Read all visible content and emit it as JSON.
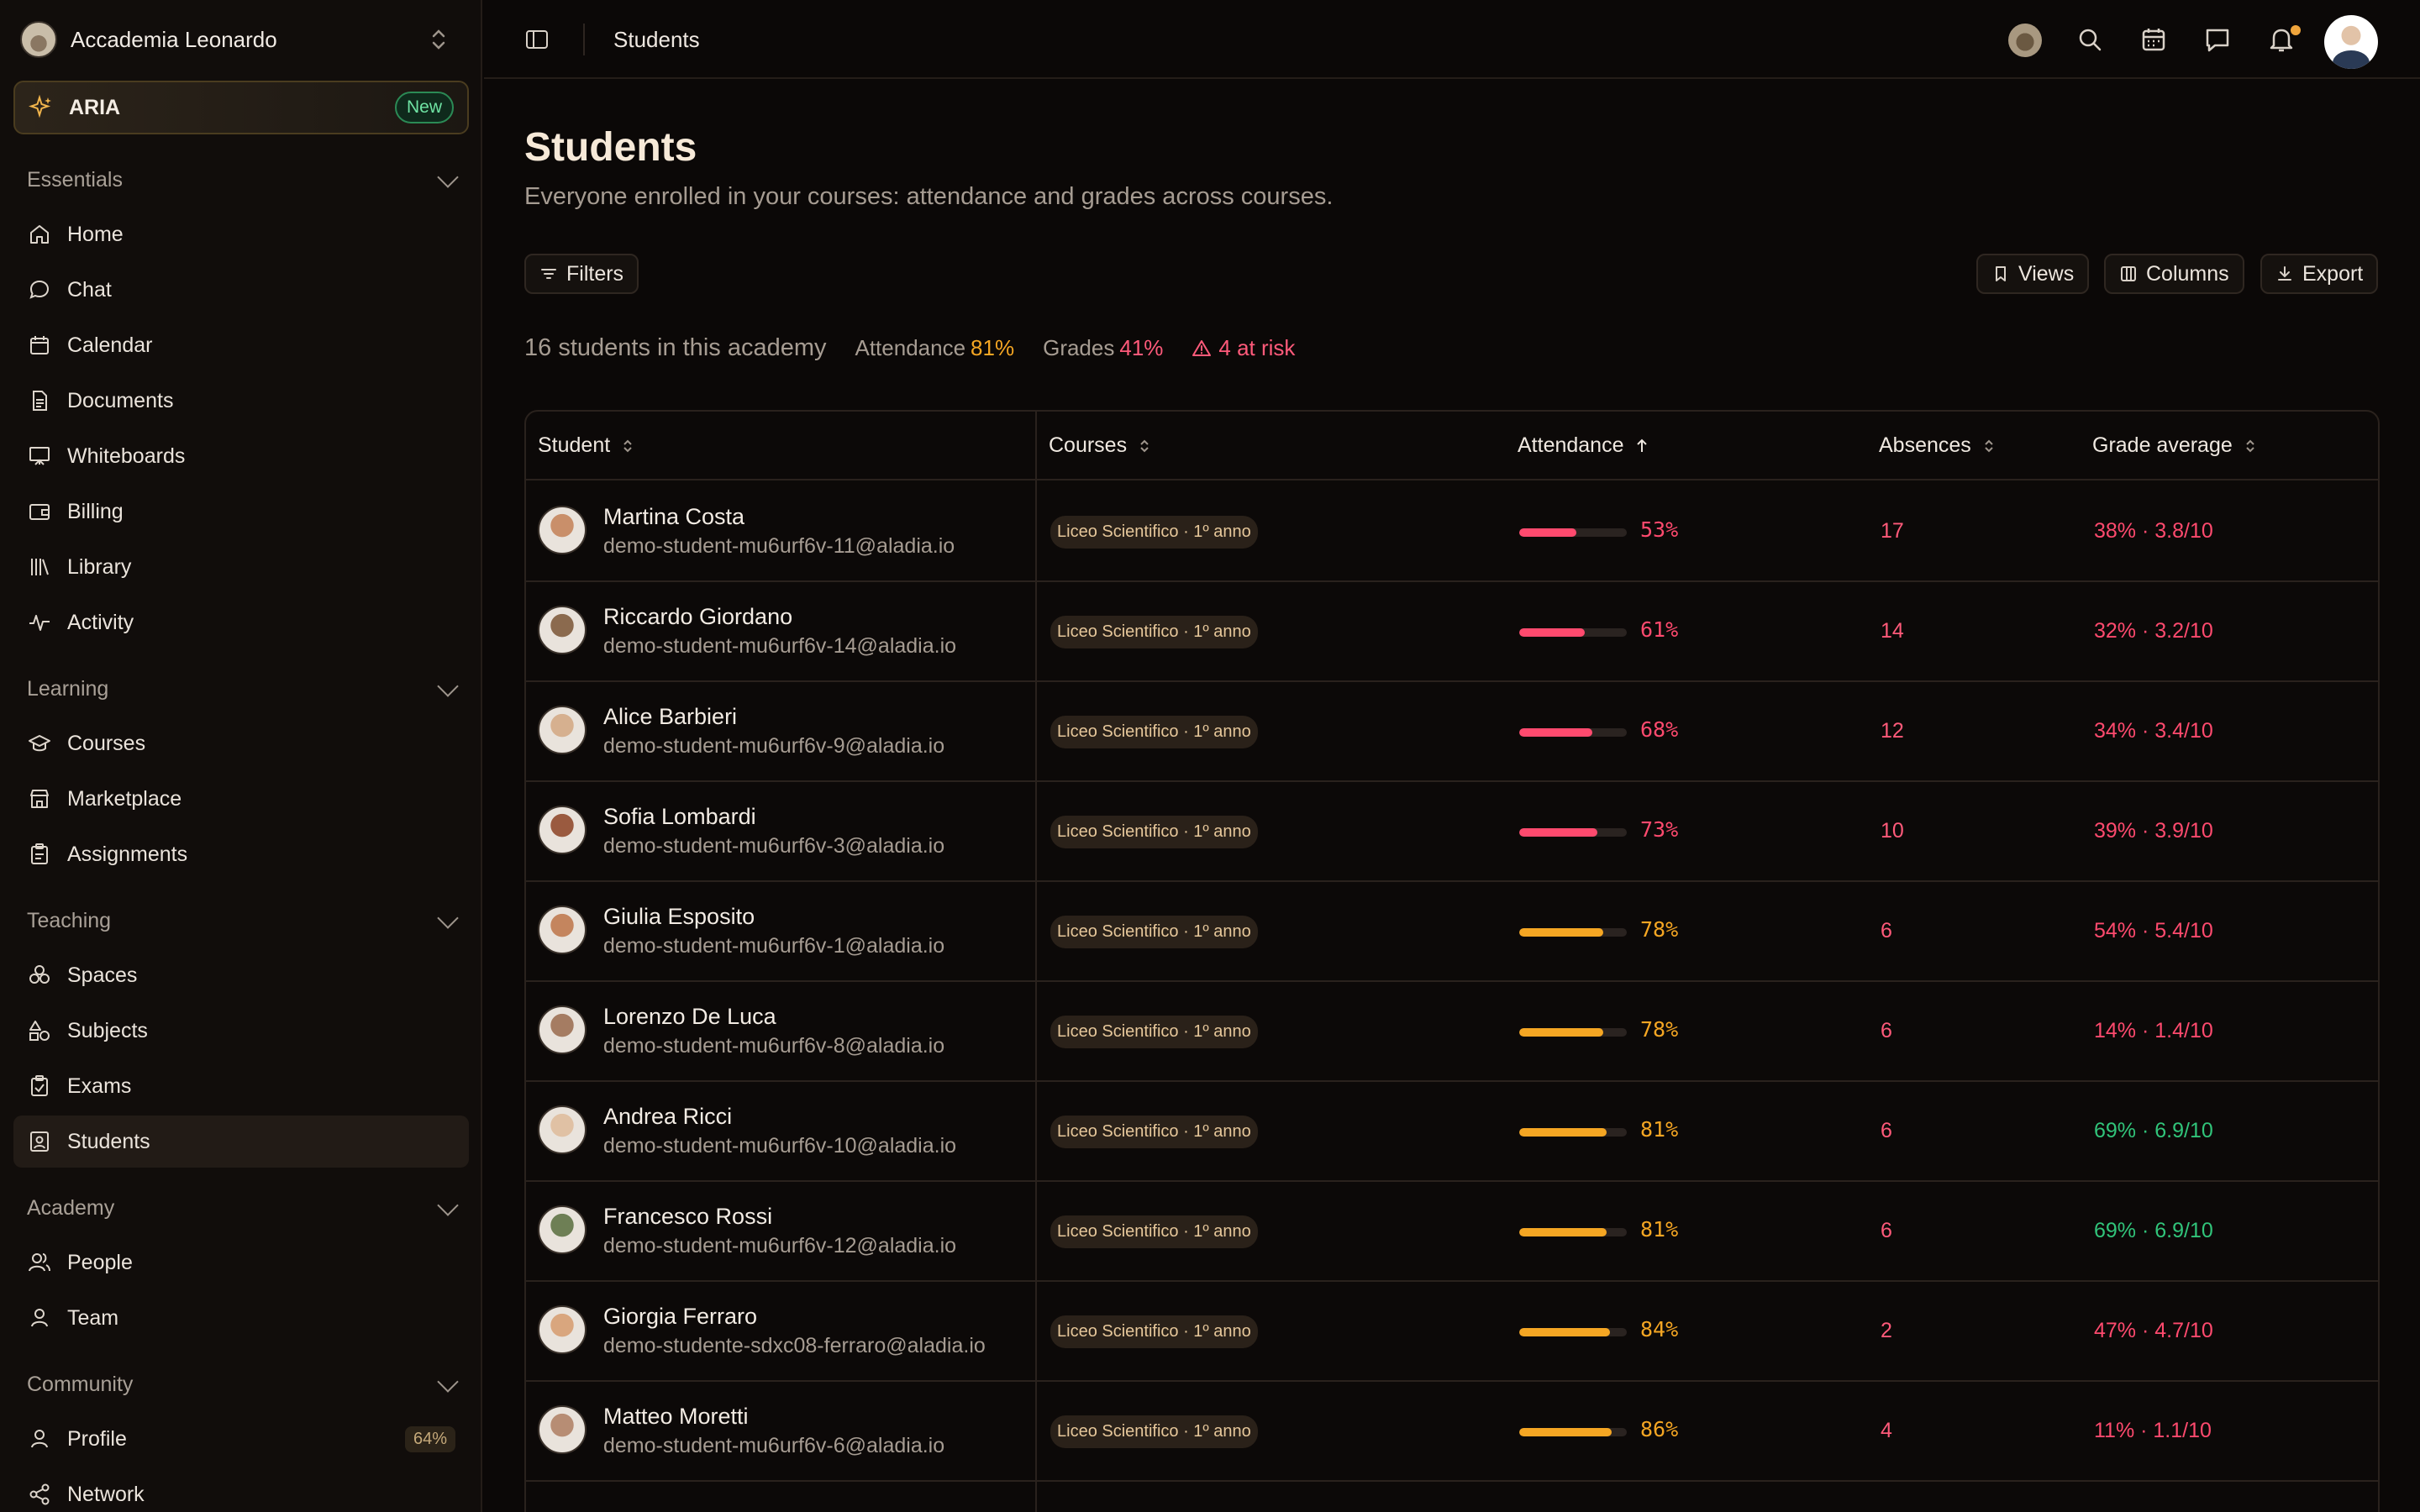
{
  "org": {
    "name": "Accademia Leonardo"
  },
  "aria": {
    "label": "ARIA",
    "badge": "New"
  },
  "sidebar": {
    "essentials": "Essentials",
    "learning": "Learning",
    "teaching": "Teaching",
    "academy": "Academy",
    "community": "Community",
    "items": {
      "home": "Home",
      "chat": "Chat",
      "calendar": "Calendar",
      "documents": "Documents",
      "whiteboards": "Whiteboards",
      "billing": "Billing",
      "library": "Library",
      "activity": "Activity",
      "courses": "Courses",
      "marketplace": "Marketplace",
      "assignments": "Assignments",
      "spaces": "Spaces",
      "subjects": "Subjects",
      "exams": "Exams",
      "students": "Students",
      "people": "People",
      "team": "Team",
      "profile": "Profile",
      "profile_pct": "64%",
      "network": "Network"
    }
  },
  "topbar": {
    "title": "Students"
  },
  "page": {
    "title": "Students",
    "subtitle": "Everyone enrolled in your courses: attendance and grades across courses."
  },
  "toolbar": {
    "filters": "Filters",
    "views": "Views",
    "columns": "Columns",
    "export": "Export"
  },
  "stats": {
    "count": "16 students in this academy",
    "attendance_label": "Attendance",
    "attendance_value": "81%",
    "grades_label": "Grades",
    "grades_value": "41%",
    "risk": "4 at risk"
  },
  "colors": {
    "red": "#ff4a6e",
    "amber": "#f5a623",
    "green": "#31c47a",
    "accent": "#f0a53c"
  },
  "table": {
    "headers": {
      "student": "Student",
      "courses": "Courses",
      "attendance": "Attendance",
      "absences": "Absences",
      "grade": "Grade average"
    },
    "rows": [
      {
        "name": "Martina Costa",
        "email": "demo-student-mu6urf6v-11@aladia.io",
        "course": "Liceo Scientifico · 1º anno",
        "attendance": "53%",
        "attendance_level": 0.53,
        "absences": "17",
        "grade": "38% · 3.8/10",
        "grade_status": "low",
        "att_status": "low"
      },
      {
        "name": "Riccardo Giordano",
        "email": "demo-student-mu6urf6v-14@aladia.io",
        "course": "Liceo Scientifico · 1º anno",
        "attendance": "61%",
        "attendance_level": 0.61,
        "absences": "14",
        "grade": "32% · 3.2/10",
        "grade_status": "low",
        "att_status": "low"
      },
      {
        "name": "Alice Barbieri",
        "email": "demo-student-mu6urf6v-9@aladia.io",
        "course": "Liceo Scientifico · 1º anno",
        "attendance": "68%",
        "attendance_level": 0.68,
        "absences": "12",
        "grade": "34% · 3.4/10",
        "grade_status": "low",
        "att_status": "low"
      },
      {
        "name": "Sofia Lombardi",
        "email": "demo-student-mu6urf6v-3@aladia.io",
        "course": "Liceo Scientifico · 1º anno",
        "attendance": "73%",
        "attendance_level": 0.73,
        "absences": "10",
        "grade": "39% · 3.9/10",
        "grade_status": "low",
        "att_status": "low"
      },
      {
        "name": "Giulia Esposito",
        "email": "demo-student-mu6urf6v-1@aladia.io",
        "course": "Liceo Scientifico · 1º anno",
        "attendance": "78%",
        "attendance_level": 0.78,
        "absences": "6",
        "grade": "54% · 5.4/10",
        "grade_status": "low",
        "att_status": "mid"
      },
      {
        "name": "Lorenzo De Luca",
        "email": "demo-student-mu6urf6v-8@aladia.io",
        "course": "Liceo Scientifico · 1º anno",
        "attendance": "78%",
        "attendance_level": 0.78,
        "absences": "6",
        "grade": "14% · 1.4/10",
        "grade_status": "low",
        "att_status": "mid"
      },
      {
        "name": "Andrea Ricci",
        "email": "demo-student-mu6urf6v-10@aladia.io",
        "course": "Liceo Scientifico · 1º anno",
        "attendance": "81%",
        "attendance_level": 0.81,
        "absences": "6",
        "grade": "69% · 6.9/10",
        "grade_status": "good",
        "att_status": "mid"
      },
      {
        "name": "Francesco Rossi",
        "email": "demo-student-mu6urf6v-12@aladia.io",
        "course": "Liceo Scientifico · 1º anno",
        "attendance": "81%",
        "attendance_level": 0.81,
        "absences": "6",
        "grade": "69% · 6.9/10",
        "grade_status": "good",
        "att_status": "mid"
      },
      {
        "name": "Giorgia Ferraro",
        "email": "demo-studente-sdxc08-ferraro@aladia.io",
        "course": "Liceo Scientifico · 1º anno",
        "attendance": "84%",
        "attendance_level": 0.84,
        "absences": "2",
        "grade": "47% · 4.7/10",
        "grade_status": "low",
        "att_status": "mid"
      },
      {
        "name": "Matteo Moretti",
        "email": "demo-student-mu6urf6v-6@aladia.io",
        "course": "Liceo Scientifico · 1º anno",
        "attendance": "86%",
        "attendance_level": 0.86,
        "absences": "4",
        "grade": "11% · 1.1/10",
        "grade_status": "low",
        "att_status": "mid"
      }
    ]
  }
}
